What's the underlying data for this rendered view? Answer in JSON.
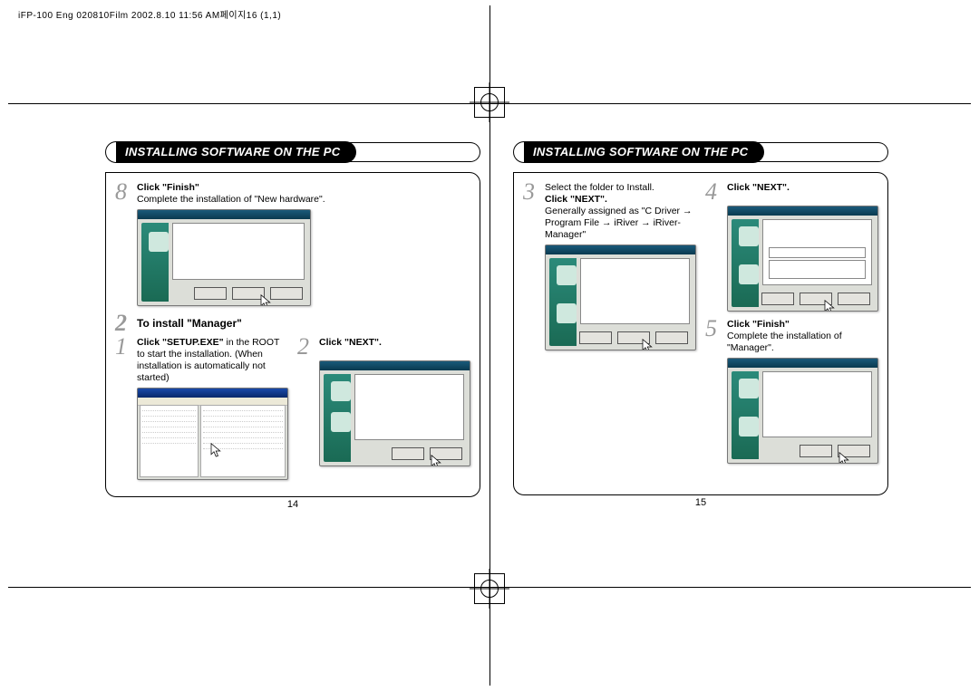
{
  "header": "iFP-100 Eng 020810Film  2002.8.10 11:56 AM페이지16 (1,1)",
  "left": {
    "title": "INSTALLING SOFTWARE ON THE PC",
    "step8_num": "8",
    "step8_bold": "Click \"Finish\"",
    "step8_text": "Complete the installation of \"New hardware\".",
    "sub_num": "2",
    "sub_text": "To install \"Manager\"",
    "step1_num": "1",
    "step1_bold": "Click \"SETUP.EXE\"",
    "step1_text": " in the ROOT to start the installation. (When installation is automatically not started)",
    "step2_num": "2",
    "step2_bold": "Click \"NEXT\".",
    "pagenum": "14"
  },
  "right": {
    "title": "INSTALLING SOFTWARE ON THE PC",
    "step3_num": "3",
    "step3_line1": "Select the folder to Install.",
    "step3_bold": "Click \"NEXT\".",
    "step3_line2": "Generally assigned as \"C Driver → Program File → iRiver → iRiver-Manager\"",
    "step4_num": "4",
    "step4_bold": "Click \"NEXT\".",
    "step5_num": "5",
    "step5_bold": "Click \"Finish\"",
    "step5_text": "Complete the installation of \"Manager\".",
    "pagenum": "15"
  }
}
